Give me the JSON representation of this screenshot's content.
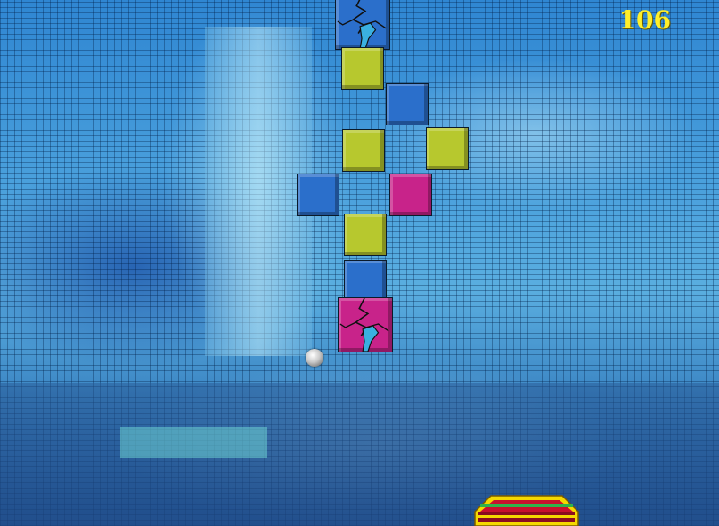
{
  "hud": {
    "score": "106"
  },
  "colors": {
    "blue": "#2b6fcb",
    "yellow": "#b7c82e",
    "magenta": "#c8238a",
    "score_text": "#ffef2a",
    "paddle_outer": "#f5d800",
    "paddle_red": "#c8102e",
    "paddle_green": "#2fb24a"
  },
  "bricks": [
    {
      "color": "blue",
      "state": "cracked"
    },
    {
      "color": "yellow",
      "state": "intact"
    },
    {
      "color": "blue",
      "state": "intact"
    },
    {
      "color": "yellow",
      "state": "intact"
    },
    {
      "color": "yellow",
      "state": "intact"
    },
    {
      "color": "blue",
      "state": "intact"
    },
    {
      "color": "magenta",
      "state": "intact"
    },
    {
      "color": "yellow",
      "state": "intact"
    },
    {
      "color": "blue",
      "state": "intact"
    },
    {
      "color": "magenta",
      "state": "cracked"
    }
  ],
  "ball": {
    "icon": "ball-icon"
  },
  "paddle": {
    "icon": "paddle-icon"
  }
}
